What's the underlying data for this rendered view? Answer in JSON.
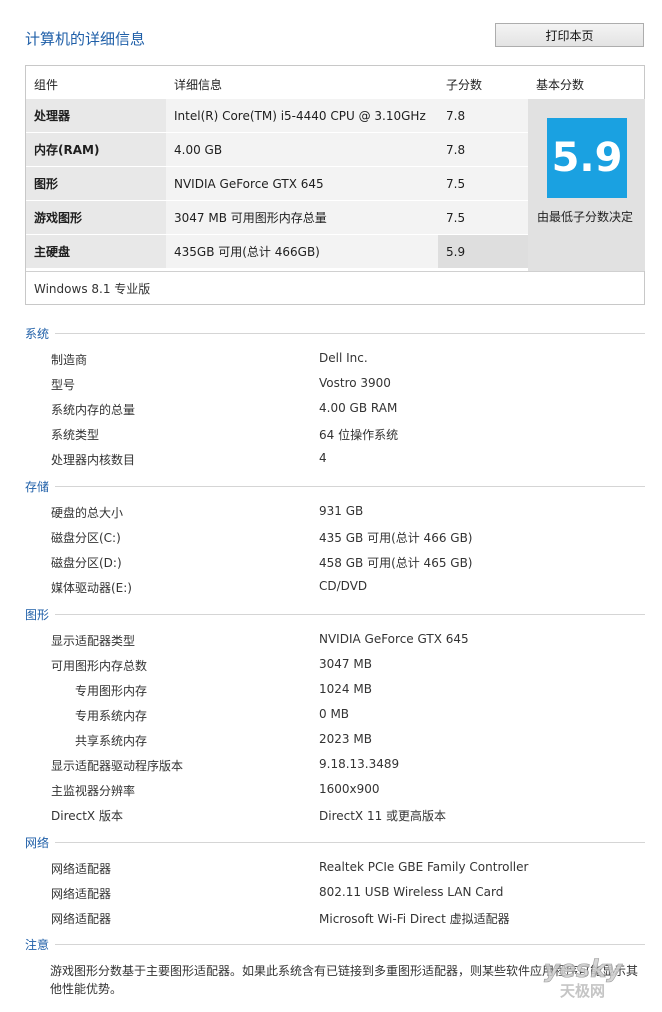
{
  "header": {
    "title": "计算机的详细信息",
    "print_label": "打印本页"
  },
  "score_table": {
    "columns": [
      "组件",
      "详细信息",
      "子分数",
      "基本分数"
    ],
    "rows": [
      {
        "component": "处理器",
        "details": "Intel(R) Core(TM) i5-4440 CPU @ 3.10GHz",
        "subscore": "7.8"
      },
      {
        "component": "内存(RAM)",
        "details": "4.00 GB",
        "subscore": "7.8"
      },
      {
        "component": "图形",
        "details": "NVIDIA GeForce GTX 645",
        "subscore": "7.5"
      },
      {
        "component": "游戏图形",
        "details": "3047 MB 可用图形内存总量",
        "subscore": "7.5"
      },
      {
        "component": "主硬盘",
        "details": "435GB 可用(总计 466GB)",
        "subscore": "5.9"
      }
    ],
    "base_score": "5.9",
    "base_label": "由最低子分数决定",
    "edition": "Windows 8.1 专业版"
  },
  "sections": {
    "system": {
      "title": "系统",
      "items": [
        {
          "label": "制造商",
          "value": "Dell Inc."
        },
        {
          "label": "型号",
          "value": "Vostro 3900"
        },
        {
          "label": "系统内存的总量",
          "value": "4.00 GB RAM"
        },
        {
          "label": "系统类型",
          "value": "64 位操作系统"
        },
        {
          "label": "处理器内核数目",
          "value": "4"
        }
      ]
    },
    "storage": {
      "title": "存储",
      "items": [
        {
          "label": "硬盘的总大小",
          "value": "931 GB"
        },
        {
          "label": "磁盘分区(C:)",
          "value": "435 GB 可用(总计 466 GB)"
        },
        {
          "label": "磁盘分区(D:)",
          "value": "458 GB 可用(总计 465 GB)"
        },
        {
          "label": "媒体驱动器(E:)",
          "value": "CD/DVD"
        }
      ]
    },
    "graphics": {
      "title": "图形",
      "items": [
        {
          "label": "显示适配器类型",
          "value": "NVIDIA GeForce GTX 645"
        },
        {
          "label": "可用图形内存总数",
          "value": "3047 MB"
        },
        {
          "label": "专用图形内存",
          "value": "1024 MB"
        },
        {
          "label": "专用系统内存",
          "value": "0 MB"
        },
        {
          "label": "共享系统内存",
          "value": "2023 MB"
        },
        {
          "label": "显示适配器驱动程序版本",
          "value": "9.18.13.3489"
        },
        {
          "label": "主监视器分辨率",
          "value": "1600x900"
        },
        {
          "label": "DirectX 版本",
          "value": "DirectX 11 或更高版本"
        }
      ]
    },
    "network": {
      "title": "网络",
      "items": [
        {
          "label": "网络适配器",
          "value": "Realtek PCIe GBE Family Controller"
        },
        {
          "label": "网络适配器",
          "value": "802.11 USB Wireless LAN Card"
        },
        {
          "label": "网络适配器",
          "value": "Microsoft Wi-Fi Direct 虚拟适配器"
        }
      ]
    },
    "notes": {
      "title": "注意",
      "text": "游戏图形分数基于主要图形适配器。如果此系统含有已链接到多重图形适配器，则某些软件应用程序可能显示其他性能优势。"
    }
  },
  "watermark": {
    "text1": "yesky",
    "text2": "天极网"
  }
}
